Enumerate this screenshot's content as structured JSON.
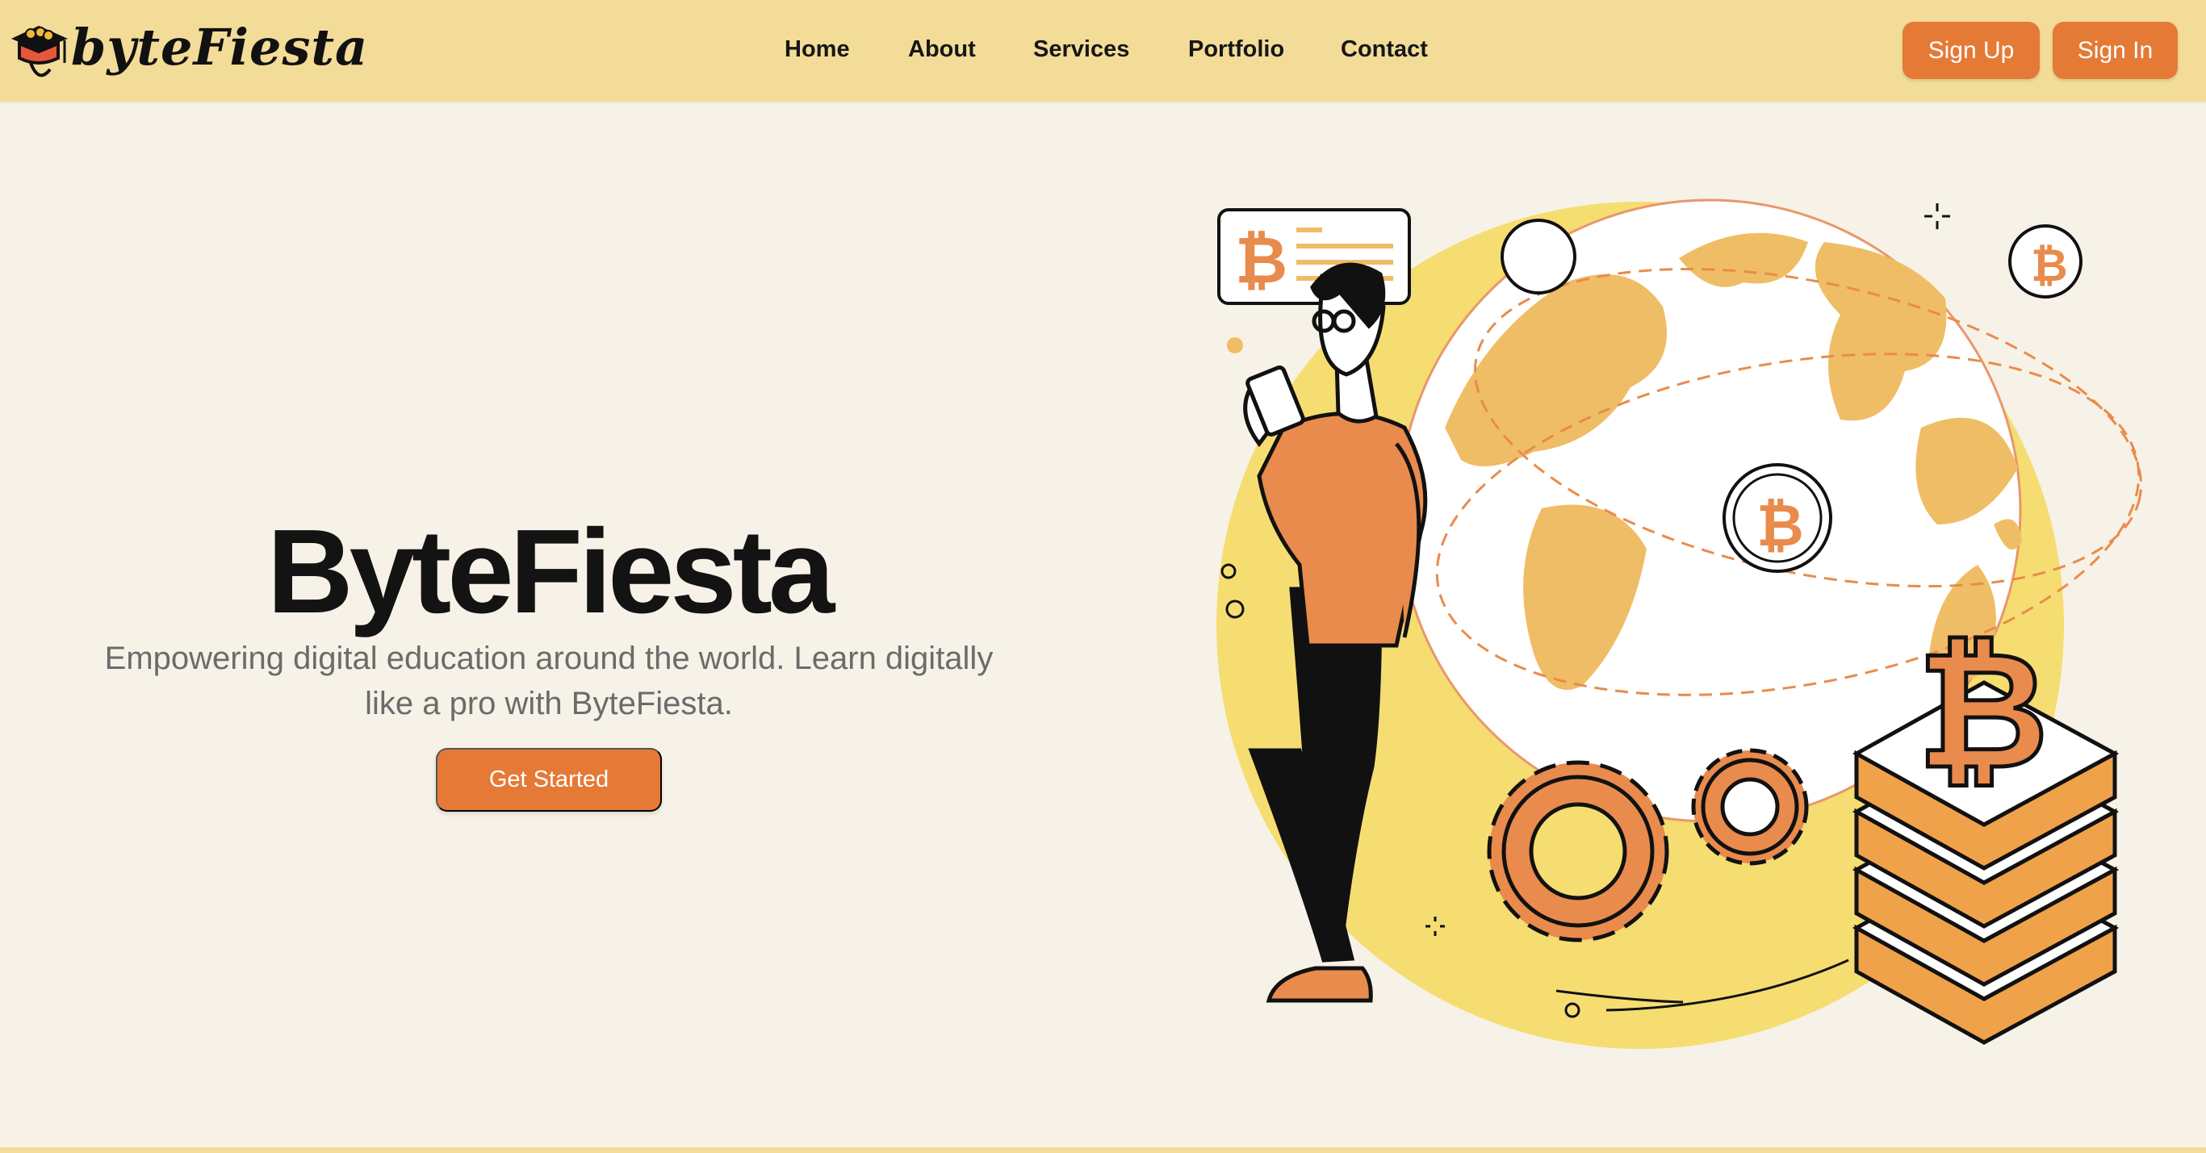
{
  "brand": {
    "logo_text": "byteFiesta"
  },
  "nav": {
    "items": [
      {
        "label": "Home"
      },
      {
        "label": "About"
      },
      {
        "label": "Services"
      },
      {
        "label": "Portfolio"
      },
      {
        "label": "Contact"
      }
    ]
  },
  "auth": {
    "signup_label": "Sign Up",
    "signin_label": "Sign In"
  },
  "hero": {
    "title": "ByteFiesta",
    "subtitle_line1": "Empowering digital education around the world. Learn digitally",
    "subtitle_line2": "like a pro with ByteFiesta.",
    "cta_label": "Get Started"
  },
  "illustration": {
    "icon": "bitcoin-globe-illustration",
    "coin_symbol": "₿"
  },
  "colors": {
    "navbar": "#f3dc98",
    "page_bg": "#f7f2e7",
    "accent": "#e47a36",
    "yellow": "#f5dd72",
    "globe_land": "#efbd65"
  }
}
